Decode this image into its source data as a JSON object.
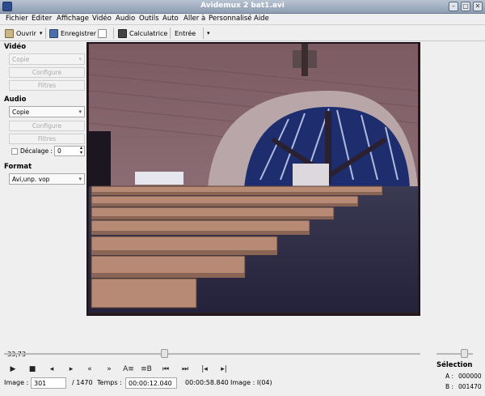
{
  "window": {
    "title": "Avidemux 2 bat1.avi"
  },
  "menu": [
    "Fichier",
    "Editer",
    "Affichage",
    "Vidéo",
    "Audio",
    "Outils",
    "Auto",
    "Aller à",
    "Personnalisé",
    "Aide"
  ],
  "toolbar": {
    "open_label": "Ouvrir",
    "save_label": "Enregistrer",
    "calc_label": "Calculatrice",
    "input_label": "Entrée"
  },
  "video": {
    "header": "Vidéo",
    "codec": "Copie",
    "configure_label": "Configure",
    "filters_label": "Filtres"
  },
  "audio": {
    "header": "Audio",
    "codec": "Copie",
    "configure_label": "Configure",
    "filters_label": "Filtres",
    "offset_label": "Décalage :",
    "offset_value": "0"
  },
  "format": {
    "header": "Format",
    "value": "Avi,unp. vop"
  },
  "timeline": {
    "position_label": "33,73"
  },
  "status": {
    "image_label": "Image :",
    "image_value": "301",
    "image_total": "/ 1470",
    "time_label": "Temps :",
    "time_value": "00:00:12.040",
    "duration": "00:00:58.840",
    "frame_type": "Image : I(04)"
  },
  "selection": {
    "header": "Sélection",
    "a_label": "A :",
    "a_value": "000000",
    "b_label": "B :",
    "b_value": "001470"
  }
}
